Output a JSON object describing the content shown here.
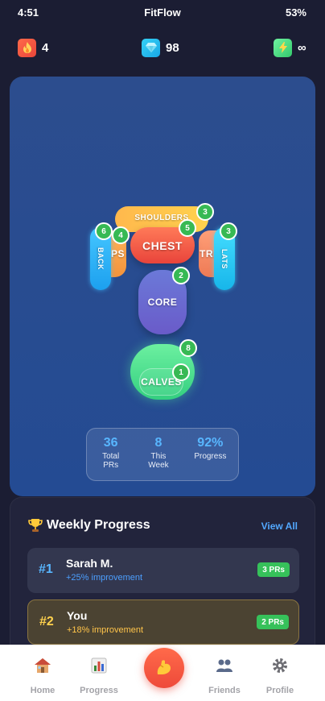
{
  "status_bar": {
    "time": "4:51",
    "title": "FitFlow",
    "battery": "53%"
  },
  "stats": {
    "streak": {
      "icon": "fire-icon",
      "value": "4"
    },
    "gems": {
      "icon": "diamond-icon",
      "value": "98"
    },
    "energy": {
      "icon": "lightning-icon",
      "value": "∞"
    }
  },
  "body_map": {
    "muscles": {
      "shoulders": {
        "label": "SHOULDERS",
        "count": "3"
      },
      "biceps": {
        "label": "EPS",
        "count": "4"
      },
      "triceps": {
        "label": "TRIC"
      },
      "chest": {
        "label": "CHEST",
        "count": "5"
      },
      "back": {
        "label": "BACK",
        "count": "6"
      },
      "lats": {
        "label": "LATS",
        "count": "3"
      },
      "core": {
        "label": "CORE",
        "count": "2"
      },
      "calves": {
        "label": "CALVES",
        "count": "1",
        "outer_count": "8"
      }
    }
  },
  "summary": {
    "total_prs": {
      "value": "36",
      "label": "Total PRs"
    },
    "this_week": {
      "value": "8",
      "label": "This Week"
    },
    "progress": {
      "value": "92%",
      "label": "Progress"
    }
  },
  "weekly": {
    "title": "Weekly Progress",
    "icon": "trophy-icon",
    "view_all": "View All",
    "rows": [
      {
        "rank": "#1",
        "name": "Sarah M.",
        "sub": "+25% improvement",
        "badge": "3 PRs"
      },
      {
        "rank": "#2",
        "name": "You",
        "sub": "+18% improvement",
        "badge": "2 PRs"
      }
    ]
  },
  "nav": {
    "home": "Home",
    "progress": "Progress",
    "friends": "Friends",
    "profile": "Profile",
    "center_icon": "flexed-arm-icon"
  },
  "colors": {
    "accent": "#52a8ff",
    "brand": "#ee4a3a",
    "success": "#36c15a",
    "gold": "#ffd24d"
  }
}
